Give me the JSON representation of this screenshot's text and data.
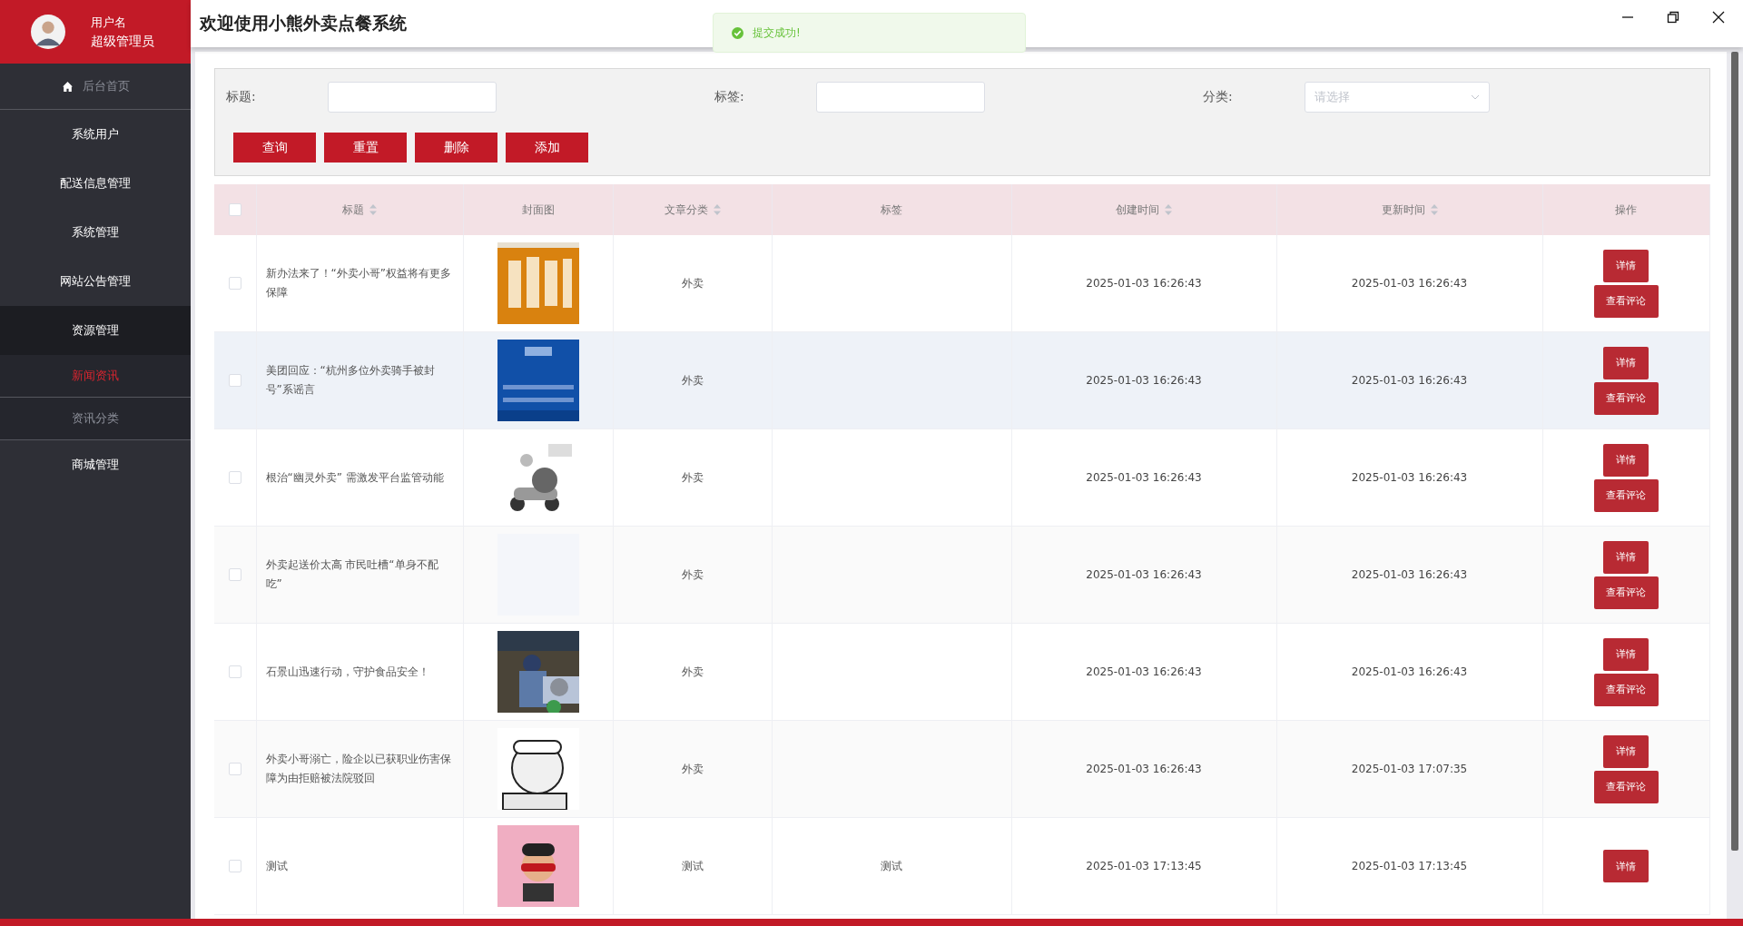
{
  "user": {
    "name": "用户名",
    "role": "超级管理员"
  },
  "header": {
    "title": "欢迎使用小熊外卖点餐系统"
  },
  "toast": {
    "message": "提交成功!"
  },
  "sidebar": {
    "items": [
      {
        "label": "后台首页",
        "kind": "home",
        "selected": false
      },
      {
        "label": "系统用户",
        "kind": "menu",
        "selected": false
      },
      {
        "label": "配送信息管理",
        "kind": "menu",
        "selected": false
      },
      {
        "label": "系统管理",
        "kind": "menu",
        "selected": false
      },
      {
        "label": "网站公告管理",
        "kind": "menu",
        "selected": false
      },
      {
        "label": "资源管理",
        "kind": "menu",
        "selected": false,
        "expanded": true,
        "children": [
          {
            "label": "新闻资讯",
            "selected": true
          },
          {
            "label": "资讯分类",
            "selected": false
          }
        ]
      },
      {
        "label": "商城管理",
        "kind": "menu",
        "selected": false
      }
    ]
  },
  "filters": [
    {
      "label": "标题:",
      "kind": "input"
    },
    {
      "label": "标签:",
      "kind": "input"
    },
    {
      "label": "分类:",
      "kind": "select",
      "placeholder": "请选择"
    }
  ],
  "buttons": [
    "查询",
    "重置",
    "删除",
    "添加"
  ],
  "table": {
    "all_checked": false,
    "columns": [
      {
        "label": "标题",
        "sortable": true
      },
      {
        "label": "封面图",
        "sortable": false
      },
      {
        "label": "文章分类",
        "sortable": true
      },
      {
        "label": "标签",
        "sortable": false
      },
      {
        "label": "创建时间",
        "sortable": true
      },
      {
        "label": "更新时间",
        "sortable": true
      },
      {
        "label": "操作",
        "sortable": false
      }
    ],
    "rows": [
      {
        "checked": false,
        "hovered": false,
        "title": "新办法来了！“外卖小哥”权益将有更多保障",
        "cover": {
          "kind": "picture"
        },
        "category": "外卖",
        "created": "2025-01-03 16:26:43",
        "updated": "2025-01-03 16:26:43",
        "actions": [
          "详情",
          "查看评论"
        ]
      },
      {
        "checked": false,
        "hovered": true,
        "title": "美团回应：“杭州多位外卖骑手被封号”系谣言",
        "cover": {
          "kind": "picture"
        },
        "category": "外卖",
        "created": "2025-01-03 16:26:43",
        "updated": "2025-01-03 16:26:43",
        "actions": [
          "详情",
          "查看评论"
        ]
      },
      {
        "checked": false,
        "hovered": false,
        "title": "根治“幽灵外卖” 需激发平台监管动能",
        "cover": {
          "kind": "picture"
        },
        "category": "外卖",
        "created": "2025-01-03 16:26:43",
        "updated": "2025-01-03 16:26:43",
        "actions": [
          "详情",
          "查看评论"
        ]
      },
      {
        "checked": false,
        "hovered": false,
        "title": "外卖起送价太高 市民吐槽“单身不配吃”",
        "cover": {
          "kind": "empty"
        },
        "category": "外卖",
        "created": "2025-01-03 16:26:43",
        "updated": "2025-01-03 16:26:43",
        "actions": [
          "详情",
          "查看评论"
        ]
      },
      {
        "checked": false,
        "hovered": false,
        "title": "石景山迅速行动，守护食品安全！",
        "cover": {
          "kind": "picture"
        },
        "category": "外卖",
        "created": "2025-01-03 16:26:43",
        "updated": "2025-01-03 16:26:43",
        "actions": [
          "详情",
          "查看评论"
        ]
      },
      {
        "checked": false,
        "hovered": false,
        "title": "外卖小哥溺亡，险企以已获职业伤害保障为由拒赔被法院驳回",
        "cover": {
          "kind": "picture"
        },
        "category": "外卖",
        "created": "2025-01-03 16:26:43",
        "updated": "2025-01-03 17:07:35",
        "actions": [
          "详情",
          "查看评论"
        ]
      },
      {
        "checked": false,
        "hovered": false,
        "title": "测试",
        "cover": {
          "kind": "picture"
        },
        "category": "测试",
        "tag": "测试",
        "created": "2025-01-03 17:13:45",
        "updated": "2025-01-03 17:13:45",
        "actions": [
          "详情"
        ]
      }
    ]
  }
}
